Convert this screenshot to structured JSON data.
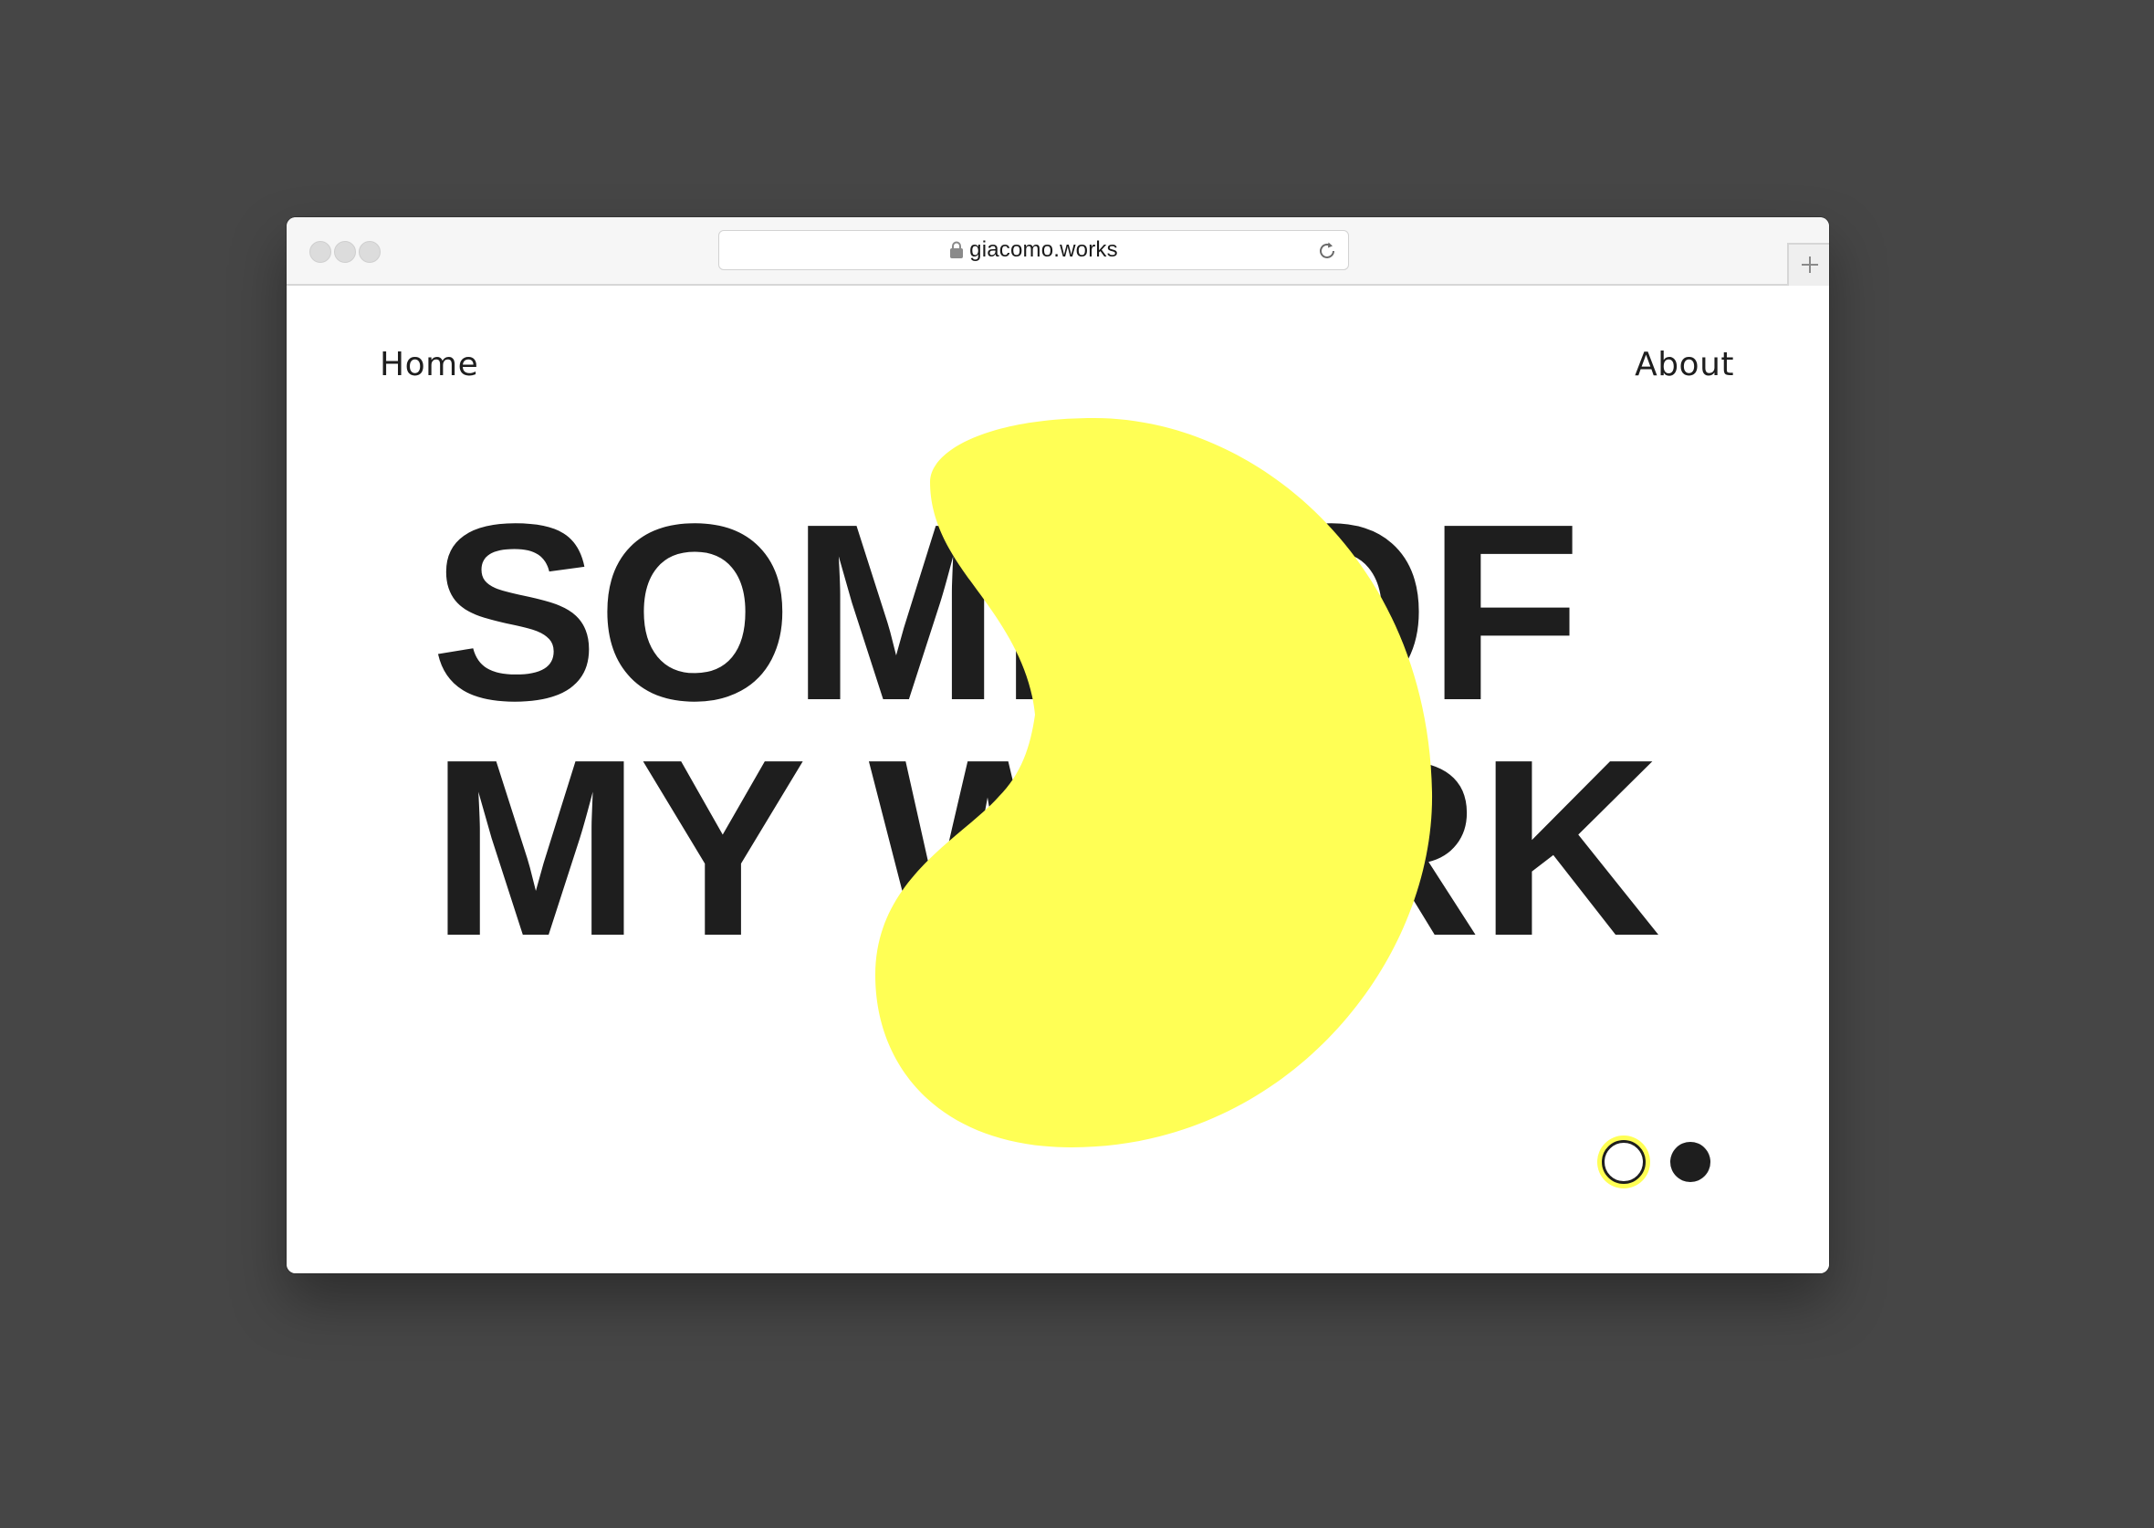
{
  "browser": {
    "url": "giacomo.works",
    "lock_icon": "lock-icon",
    "reload_icon": "reload-icon",
    "new_tab_icon": "plus-icon"
  },
  "nav": {
    "home_label": "Home",
    "about_label": "About"
  },
  "hero": {
    "line1": "SOME OF",
    "line2": "MY WORK"
  },
  "theme": {
    "background": "#464646",
    "accent_yellow": "#ffff55",
    "text_dark": "#1e1e1e"
  },
  "theme_toggle": {
    "options": [
      "light",
      "dark"
    ],
    "selected": "light"
  }
}
